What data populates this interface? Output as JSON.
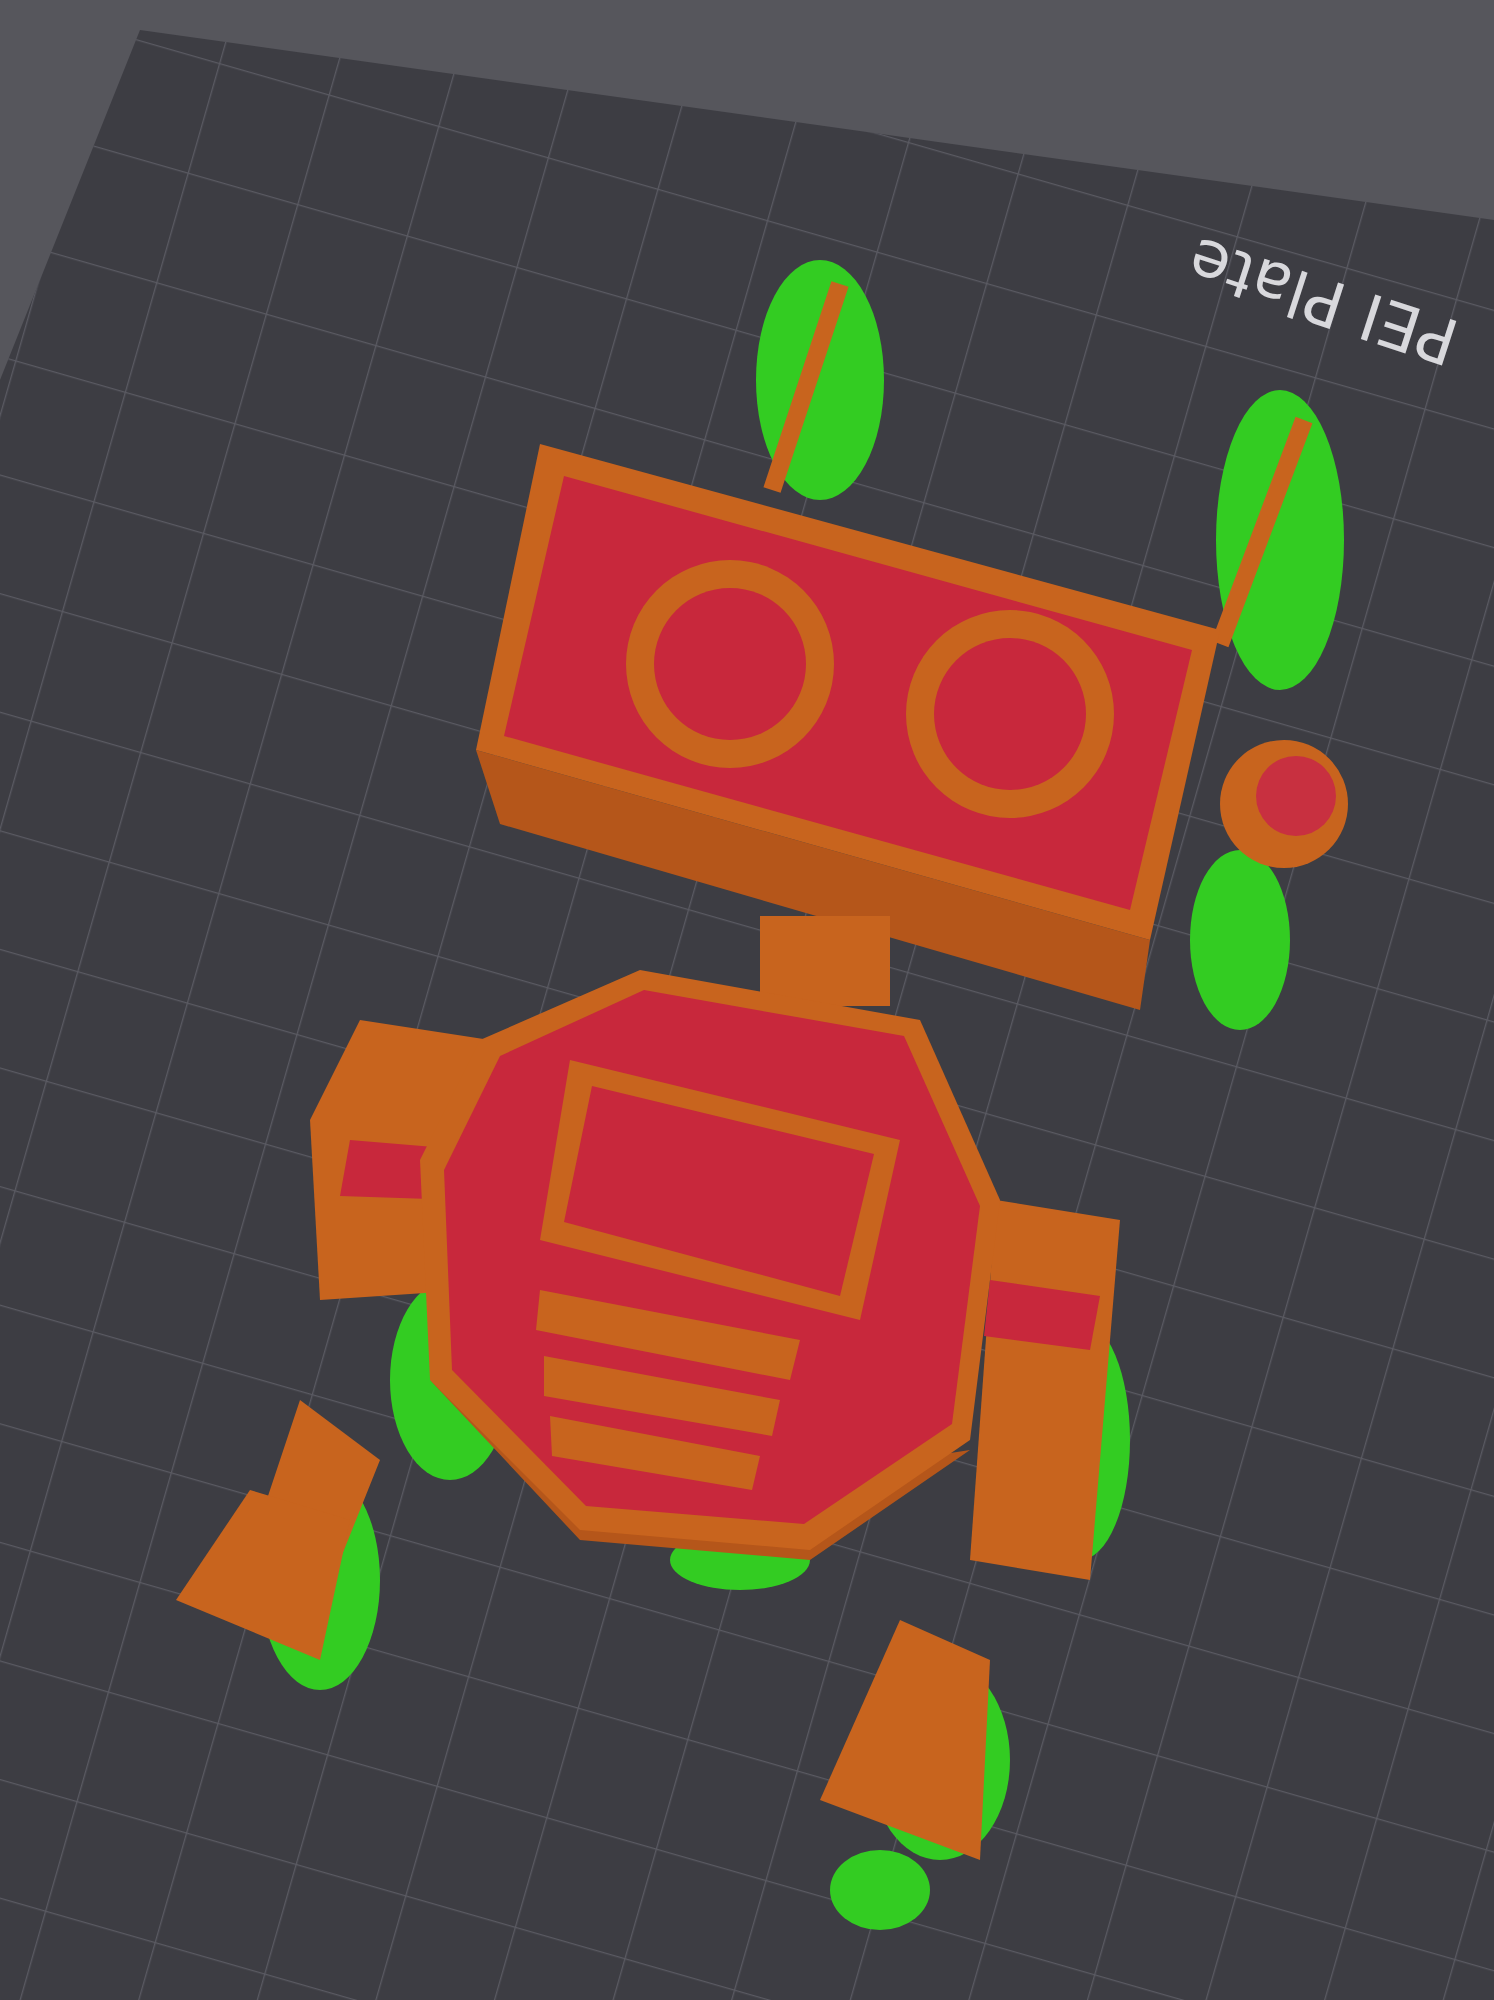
{
  "viewport": {
    "plate_label": "PEI Plate"
  }
}
